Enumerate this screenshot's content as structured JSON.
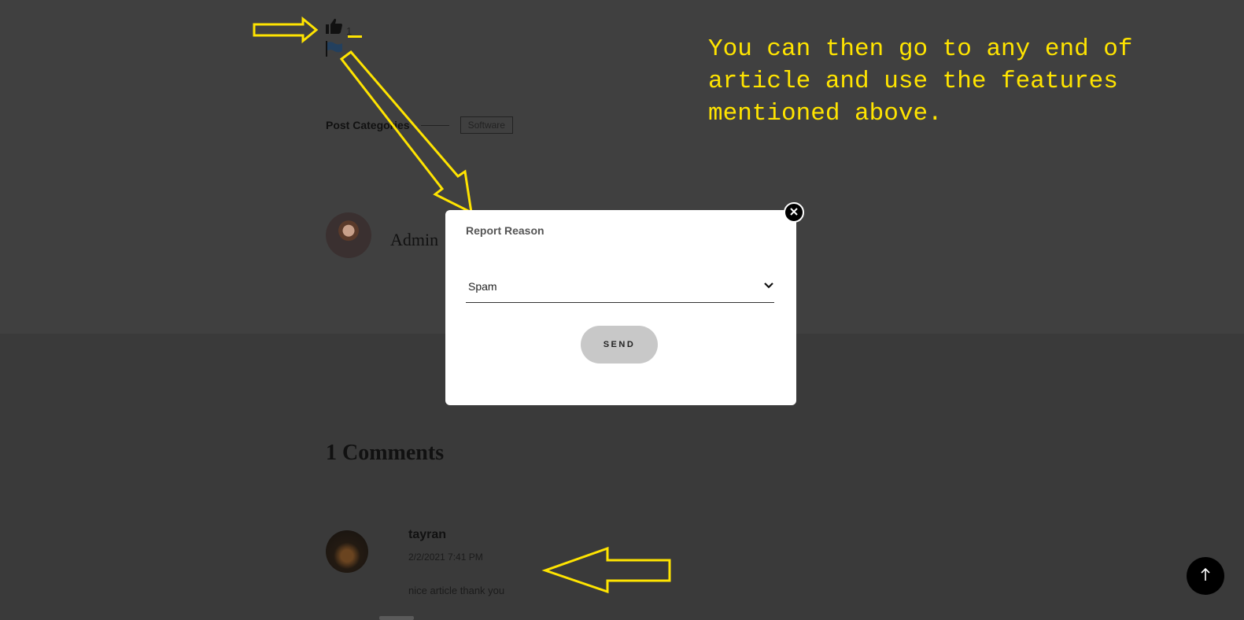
{
  "post": {
    "like_count": "1",
    "category_label": "Post Categories",
    "category_tag": "Software",
    "author_name": "Admin"
  },
  "annotation": {
    "text": "You can then go to any end of article and use the features mentioned above.",
    "color": "#ffe400"
  },
  "modal": {
    "title": "Report Reason",
    "select_value": "Spam",
    "send_label": "SEND"
  },
  "comments": {
    "title": "1 Comments",
    "items": [
      {
        "author": "tayran",
        "date": "2/2/2021 7:41 PM",
        "text": "nice article thank you"
      }
    ]
  },
  "icons": {
    "like": "thumbs-up-icon",
    "report": "flag-icon",
    "close": "close-icon",
    "dropdown": "chevron-down-icon",
    "scroll_top": "arrow-up-icon"
  }
}
